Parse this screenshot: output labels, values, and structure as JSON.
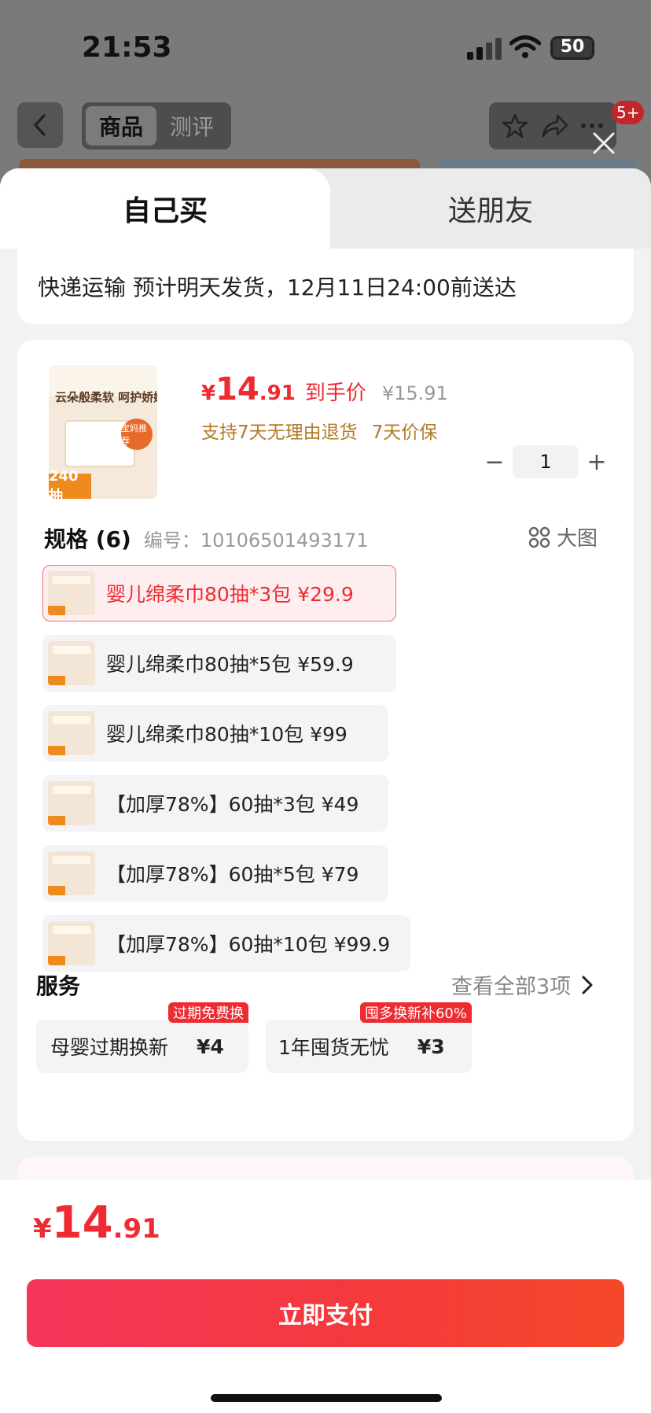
{
  "status_bar": {
    "time": "21:53",
    "battery": "50"
  },
  "nav": {
    "tabs": [
      "商品",
      "测评"
    ],
    "badge": "5+"
  },
  "sheet_tabs": {
    "self": "自己买",
    "gift": "送朋友"
  },
  "shipping": {
    "text": "快递运输 预计明天发货，12月11日24:00前送达"
  },
  "product": {
    "image": {
      "title": "云朵般柔软 呵护娇嫩肌",
      "tag": "宝妈推荐",
      "count": "240抽"
    },
    "price": {
      "currency": "¥",
      "integer": "14",
      "decimal": ".91",
      "label": "到手价",
      "original": "¥15.91"
    },
    "guarantees": [
      "支持7天无理由退货",
      "7天价保"
    ],
    "quantity": {
      "value": "1",
      "minus": "−",
      "plus": "+"
    }
  },
  "specs": {
    "title": "规格 (6)",
    "code": "编号：10106501493171",
    "big_image": "大图",
    "options": [
      {
        "label": "婴儿绵柔巾80抽*3包   ¥29.9",
        "selected": true
      },
      {
        "label": "婴儿绵柔巾80抽*5包   ¥59.9",
        "selected": false
      },
      {
        "label": "婴儿绵柔巾80抽*10包   ¥99",
        "selected": false
      },
      {
        "label": "【加厚78%】60抽*3包   ¥49",
        "selected": false
      },
      {
        "label": "【加厚78%】60抽*5包   ¥79",
        "selected": false
      },
      {
        "label": "【加厚78%】60抽*10包   ¥99.9",
        "selected": false
      }
    ]
  },
  "services": {
    "title": "服务",
    "view_all": "查看全部3项",
    "items": [
      {
        "name": "母婴过期换新",
        "price": "¥4",
        "tag": "过期免费换"
      },
      {
        "name": "1年囤货无忧",
        "price": "¥3",
        "tag": "囤多换新补60%"
      }
    ]
  },
  "footer": {
    "price": {
      "currency": "¥",
      "integer": "14",
      "decimal": ".91"
    },
    "pay_button": "立即支付"
  },
  "colors": {
    "accent": "#ee2a32",
    "gold": "#b37a2a"
  }
}
